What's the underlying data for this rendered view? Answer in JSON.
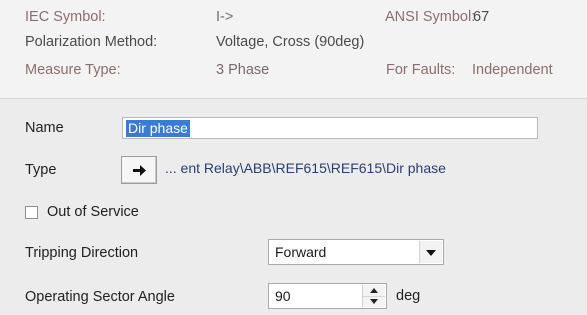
{
  "info": {
    "iec_symbol_label": "IEC Symbol:",
    "iec_symbol_value": "I->",
    "ansi_symbol_label": "ANSI Symbol:",
    "ansi_symbol_value": "67",
    "polarization_label": "Polarization Method:",
    "polarization_value": "Voltage, Cross (90deg)",
    "measure_type_label": "Measure Type:",
    "measure_type_value": "3 Phase",
    "for_faults_label": "For Faults:",
    "for_faults_value": "Independent"
  },
  "form": {
    "name_label": "Name",
    "name_value": "Dir phase",
    "type_label": "Type",
    "type_path": "... ent Relay\\ABB\\REF615\\REF615\\Dir phase",
    "out_of_service_label": "Out of Service",
    "out_of_service_checked": false,
    "tripping_direction_label": "Tripping Direction",
    "tripping_direction_value": "Forward",
    "operating_sector_label": "Operating Sector Angle",
    "operating_sector_value": "90",
    "operating_sector_unit": "deg"
  },
  "icons": {
    "type_button": "arrow-right-icon",
    "combo_button": "chevron-down-icon",
    "spin_up": "spin-up-icon",
    "spin_down": "spin-down-icon"
  },
  "colors": {
    "selection": "#3a7bd5",
    "info_label": "#8c6e6e",
    "path_text": "#2a3f6e"
  }
}
